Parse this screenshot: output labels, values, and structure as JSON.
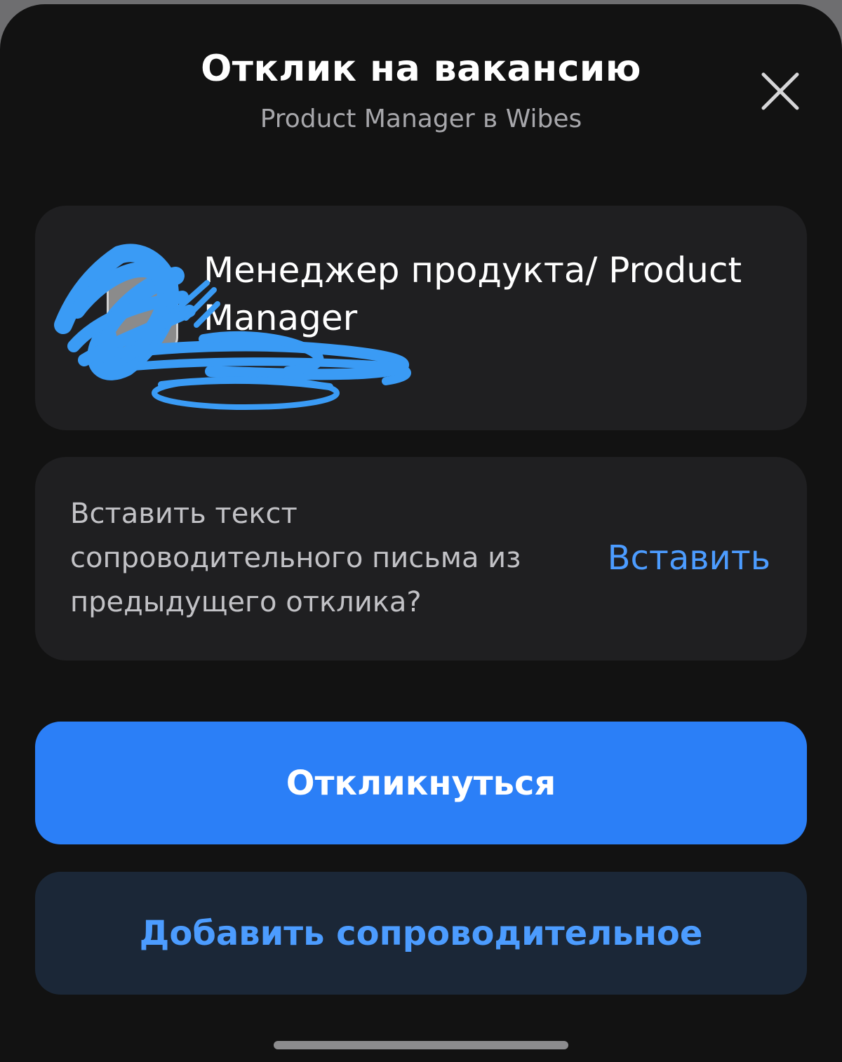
{
  "header": {
    "title": "Отклик на вакансию",
    "subtitle": "Product Manager в Wibes",
    "close_icon": "close-icon"
  },
  "vacancy": {
    "name": "Менеджер продукта/ Product Manager",
    "logo_icon": "company-logo",
    "redaction_color": "#3a9bf5"
  },
  "paste_prompt": {
    "text": "Вставить текст сопроводительного письма из предыдущего отклика?",
    "action_label": "Вставить"
  },
  "actions": {
    "respond_label": "Откликнуться",
    "add_cover_letter_label": "Добавить сопроводительное"
  },
  "colors": {
    "background": "#121212",
    "card": "#1f1f21",
    "accent": "#2b7ff7",
    "link": "#4c9cff",
    "secondary_button": "#1b2737"
  }
}
